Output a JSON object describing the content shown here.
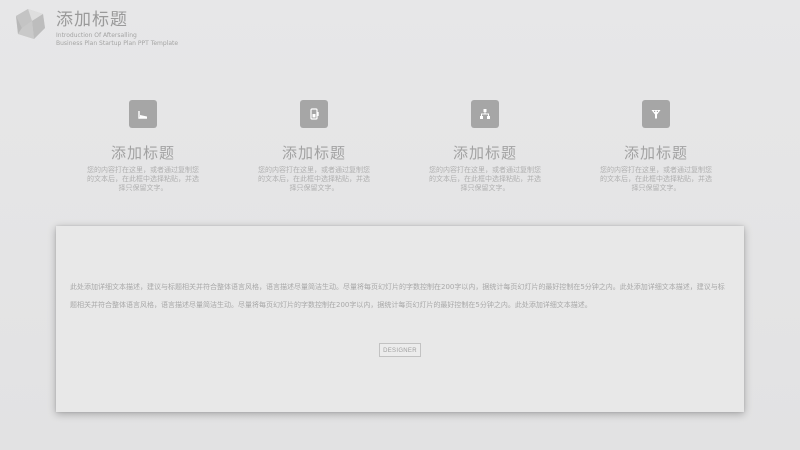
{
  "header": {
    "title": "添加标题",
    "subtitle_line1": "Introduction Of Aftersalling",
    "subtitle_line2": "Business Plan Startup Plan PPT Template"
  },
  "features": [
    {
      "icon": "chart-line-icon",
      "title": "添加标题",
      "text": "您的内容打在这里，或者通过复制您的文本后，在此框中选择粘贴，并选择只保留文字。"
    },
    {
      "icon": "battery-icon",
      "title": "添加标题",
      "text": "您的内容打在这里，或者通过复制您的文本后，在此框中选择粘贴，并选择只保留文字。"
    },
    {
      "icon": "network-icon",
      "title": "添加标题",
      "text": "您的内容打在这里，或者通过复制您的文本后，在此框中选择粘贴，并选择只保留文字。"
    },
    {
      "icon": "funnel-icon",
      "title": "添加标题",
      "text": "您的内容打在这里，或者通过复制您的文本后，在此框中选择粘贴，并选择只保留文字。"
    }
  ],
  "card": {
    "text": "此处添加详细文本描述，建议与标题相关并符合整体语言风格，语言描述尽量简洁生动。尽量将每页幻灯片的字数控制在200字以内，据统计每页幻灯片的最好控制在5分钟之内。此处添加详细文本描述，建议与标题相关并符合整体语言风格，语言描述尽量简洁生动。尽量将每页幻灯片的字数控制在200字以内，据统计每页幻灯片的最好控制在5分钟之内。此处添加详细文本描述。",
    "button_label": "DESIGNER"
  },
  "colors": {
    "background": "#e4e4e5",
    "icon_box": "#a6a6a6",
    "card": "#e8e8e8"
  }
}
